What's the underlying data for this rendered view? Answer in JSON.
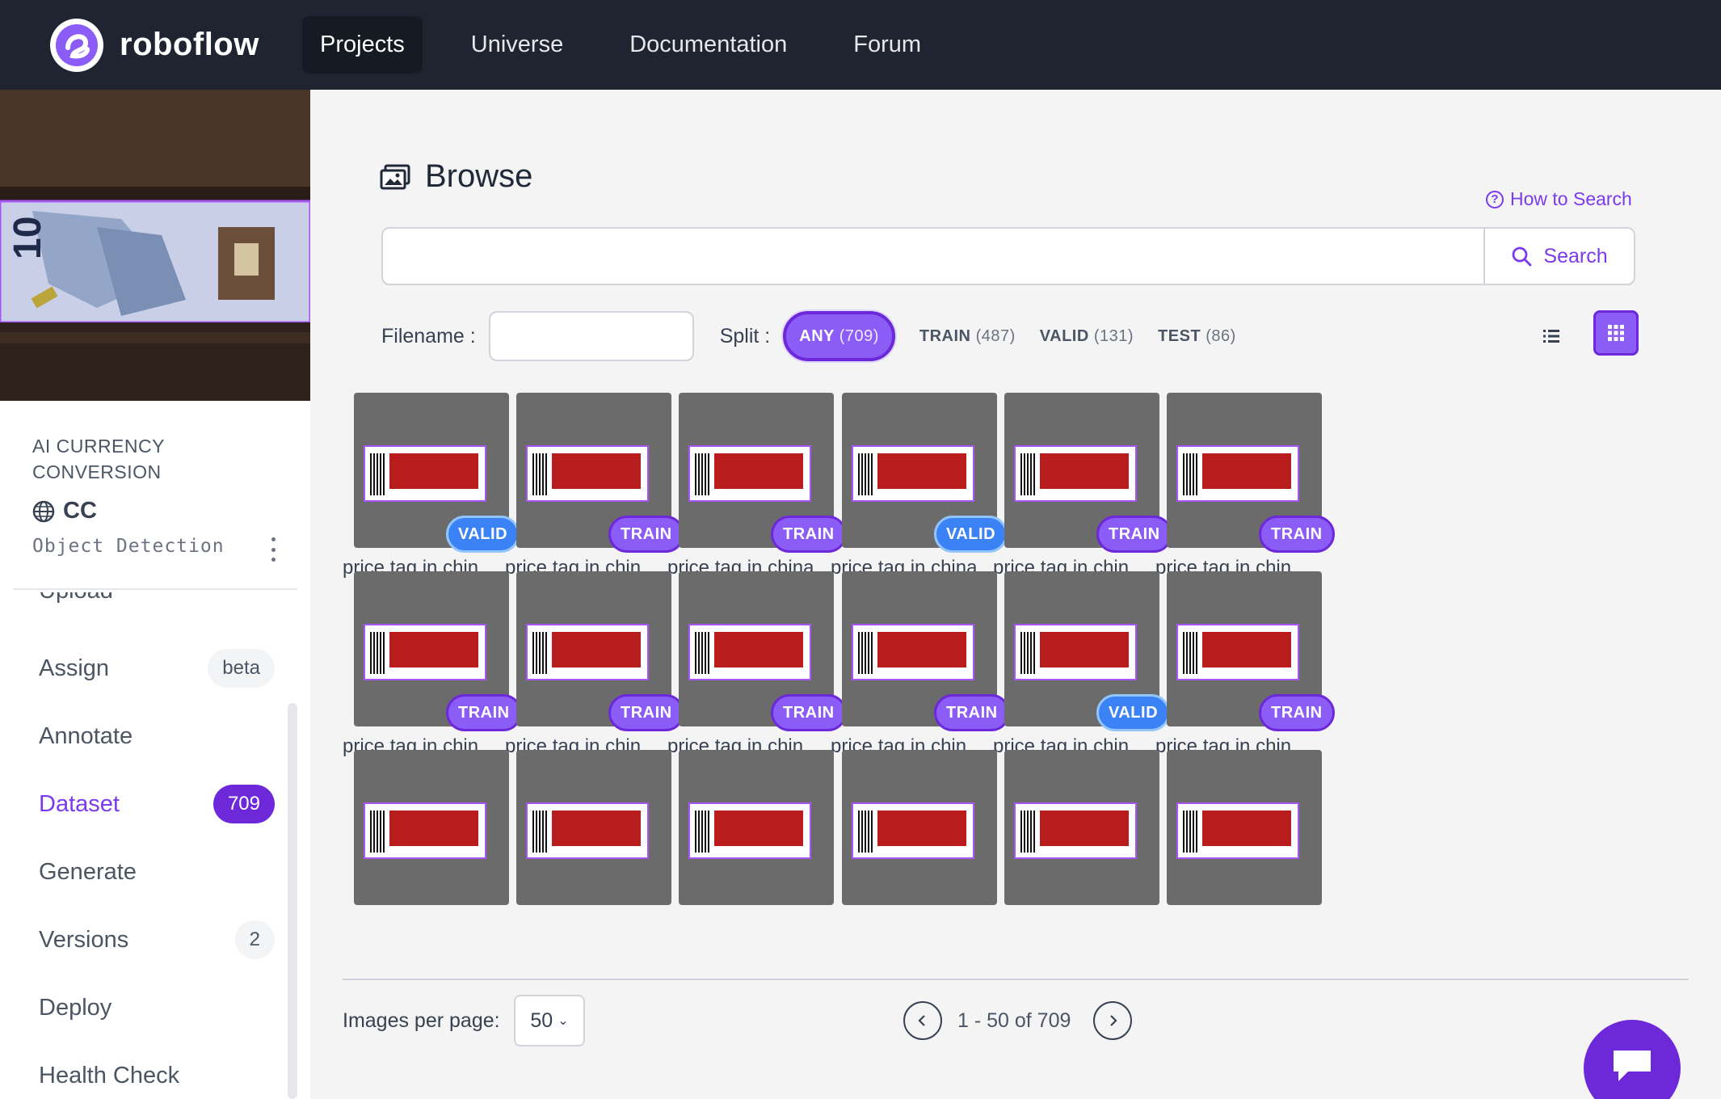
{
  "app": {
    "name": "roboflow"
  },
  "nav": [
    {
      "label": "Projects",
      "active": true
    },
    {
      "label": "Universe",
      "active": false
    },
    {
      "label": "Documentation",
      "active": false
    },
    {
      "label": "Forum",
      "active": false
    }
  ],
  "project": {
    "category": "AI CURRENCY CONVERSION",
    "name": "CC",
    "type": "Object Detection"
  },
  "menu": [
    {
      "label": "Upload",
      "badge": ""
    },
    {
      "label": "Assign",
      "badge": "beta"
    },
    {
      "label": "Annotate",
      "badge": ""
    },
    {
      "label": "Dataset",
      "badge": "709",
      "active": true
    },
    {
      "label": "Generate",
      "badge": ""
    },
    {
      "label": "Versions",
      "badge": "2"
    },
    {
      "label": "Deploy",
      "badge": ""
    },
    {
      "label": "Health Check",
      "badge": ""
    }
  ],
  "browse": {
    "title": "Browse",
    "how_to": "How to Search",
    "search_value": "",
    "search_button": "Search",
    "filename_label": "Filename :",
    "filename_value": "",
    "split_label": "Split :",
    "splits": [
      {
        "label": "ANY",
        "count": "(709)",
        "active": true
      },
      {
        "label": "TRAIN",
        "count": "(487)"
      },
      {
        "label": "VALID",
        "count": "(131)"
      },
      {
        "label": "TEST",
        "count": "(86)"
      }
    ]
  },
  "images": [
    {
      "caption": "price tag in chin...",
      "split": "VALID"
    },
    {
      "caption": "price tag in chin...",
      "split": "TRAIN"
    },
    {
      "caption": "price tag in china...",
      "split": "TRAIN"
    },
    {
      "caption": "price tag in china...",
      "split": "VALID"
    },
    {
      "caption": "price tag in chin...",
      "split": "TRAIN"
    },
    {
      "caption": "price tag in chin...",
      "split": "TRAIN"
    },
    {
      "caption": "price tag in chin...",
      "split": "TRAIN"
    },
    {
      "caption": "price tag in chin...",
      "split": "TRAIN"
    },
    {
      "caption": "price tag in chin...",
      "split": "TRAIN"
    },
    {
      "caption": "price tag in chin...",
      "split": "TRAIN"
    },
    {
      "caption": "price tag in chin...",
      "split": "VALID"
    },
    {
      "caption": "price tag in chin...",
      "split": "TRAIN"
    },
    {
      "caption": "",
      "split": ""
    },
    {
      "caption": "",
      "split": ""
    },
    {
      "caption": "",
      "split": ""
    },
    {
      "caption": "",
      "split": ""
    },
    {
      "caption": "",
      "split": ""
    },
    {
      "caption": "",
      "split": ""
    }
  ],
  "pagination": {
    "per_page_label": "Images per page:",
    "per_page": "50",
    "range": "1 - 50 of 709"
  },
  "colors": {
    "accent": "#8b5cf6",
    "nav_bg": "#1f2430",
    "valid": "#3b82f6"
  }
}
